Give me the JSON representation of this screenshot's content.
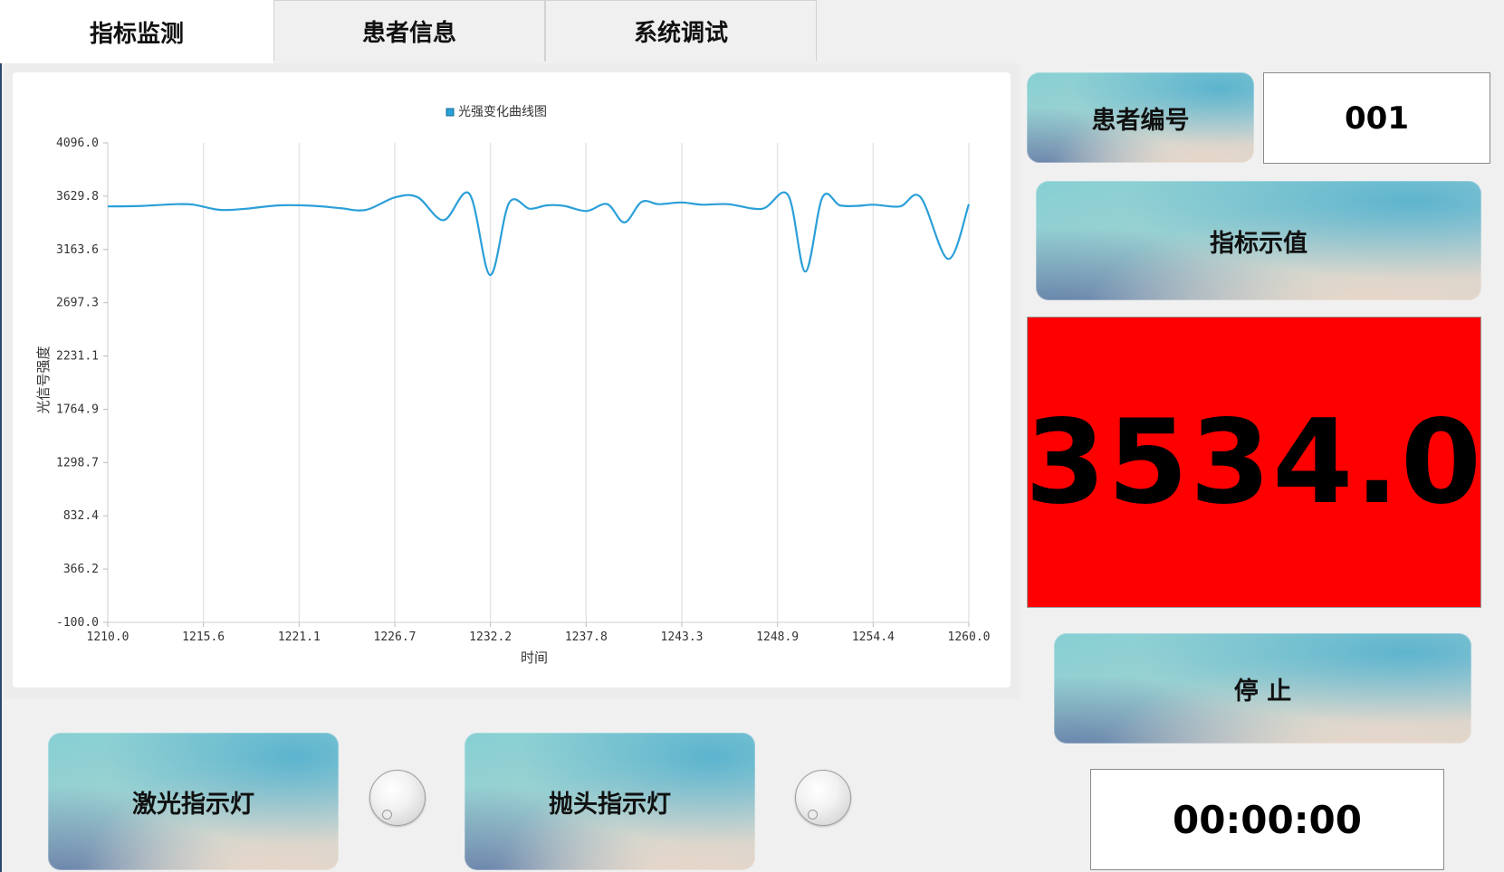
{
  "tabs": [
    {
      "label": "指标监测",
      "active": true
    },
    {
      "label": "患者信息",
      "active": false
    },
    {
      "label": "系统调试",
      "active": false
    }
  ],
  "patient": {
    "label": "患者编号",
    "value": "001"
  },
  "indicator": {
    "label": "指标示值",
    "value": "3534.0",
    "background": "#ff0000"
  },
  "stop_button": {
    "label": "停 止"
  },
  "timer": {
    "value": "00:00:00"
  },
  "laser_button": {
    "label": "激光指示灯"
  },
  "probe_button": {
    "label": "抛头指示灯"
  },
  "chart_data": {
    "type": "line",
    "legend": "光强变化曲线图",
    "legend_position": "top-center",
    "xlabel": "时间",
    "ylabel": "光信号强度",
    "xlim": [
      1210.0,
      1260.0
    ],
    "ylim": [
      -100.0,
      4096.0
    ],
    "x_ticks": [
      "1210.0",
      "1215.6",
      "1221.1",
      "1226.7",
      "1232.2",
      "1237.8",
      "1243.3",
      "1248.9",
      "1254.4",
      "1260.0"
    ],
    "y_ticks": [
      "4096.0",
      "3629.8",
      "3163.6",
      "2697.3",
      "2231.1",
      "1764.9",
      "1298.7",
      "832.4",
      "366.2",
      "-100.0"
    ],
    "grid_vertical": true,
    "series": [
      {
        "name": "光强变化曲线图",
        "color": "#2a9fd8",
        "x": [
          1210,
          1212,
          1214,
          1215,
          1216.5,
          1218,
          1220,
          1222,
          1223.5,
          1225,
          1226.7,
          1228,
          1229.5,
          1231,
          1232.2,
          1233.3,
          1234.5,
          1235.5,
          1236.5,
          1237.8,
          1239,
          1240,
          1241,
          1242,
          1243.3,
          1244.5,
          1246,
          1248,
          1249.5,
          1250.5,
          1251.5,
          1252.5,
          1253.5,
          1254.5,
          1256,
          1257.2,
          1258.8,
          1260
        ],
        "y": [
          3540,
          3545,
          3560,
          3555,
          3510,
          3520,
          3550,
          3545,
          3525,
          3510,
          3620,
          3620,
          3420,
          3650,
          2940,
          3570,
          3520,
          3550,
          3545,
          3500,
          3560,
          3400,
          3580,
          3560,
          3575,
          3555,
          3560,
          3520,
          3640,
          2970,
          3620,
          3550,
          3545,
          3555,
          3540,
          3620,
          3080,
          3560
        ]
      }
    ]
  }
}
